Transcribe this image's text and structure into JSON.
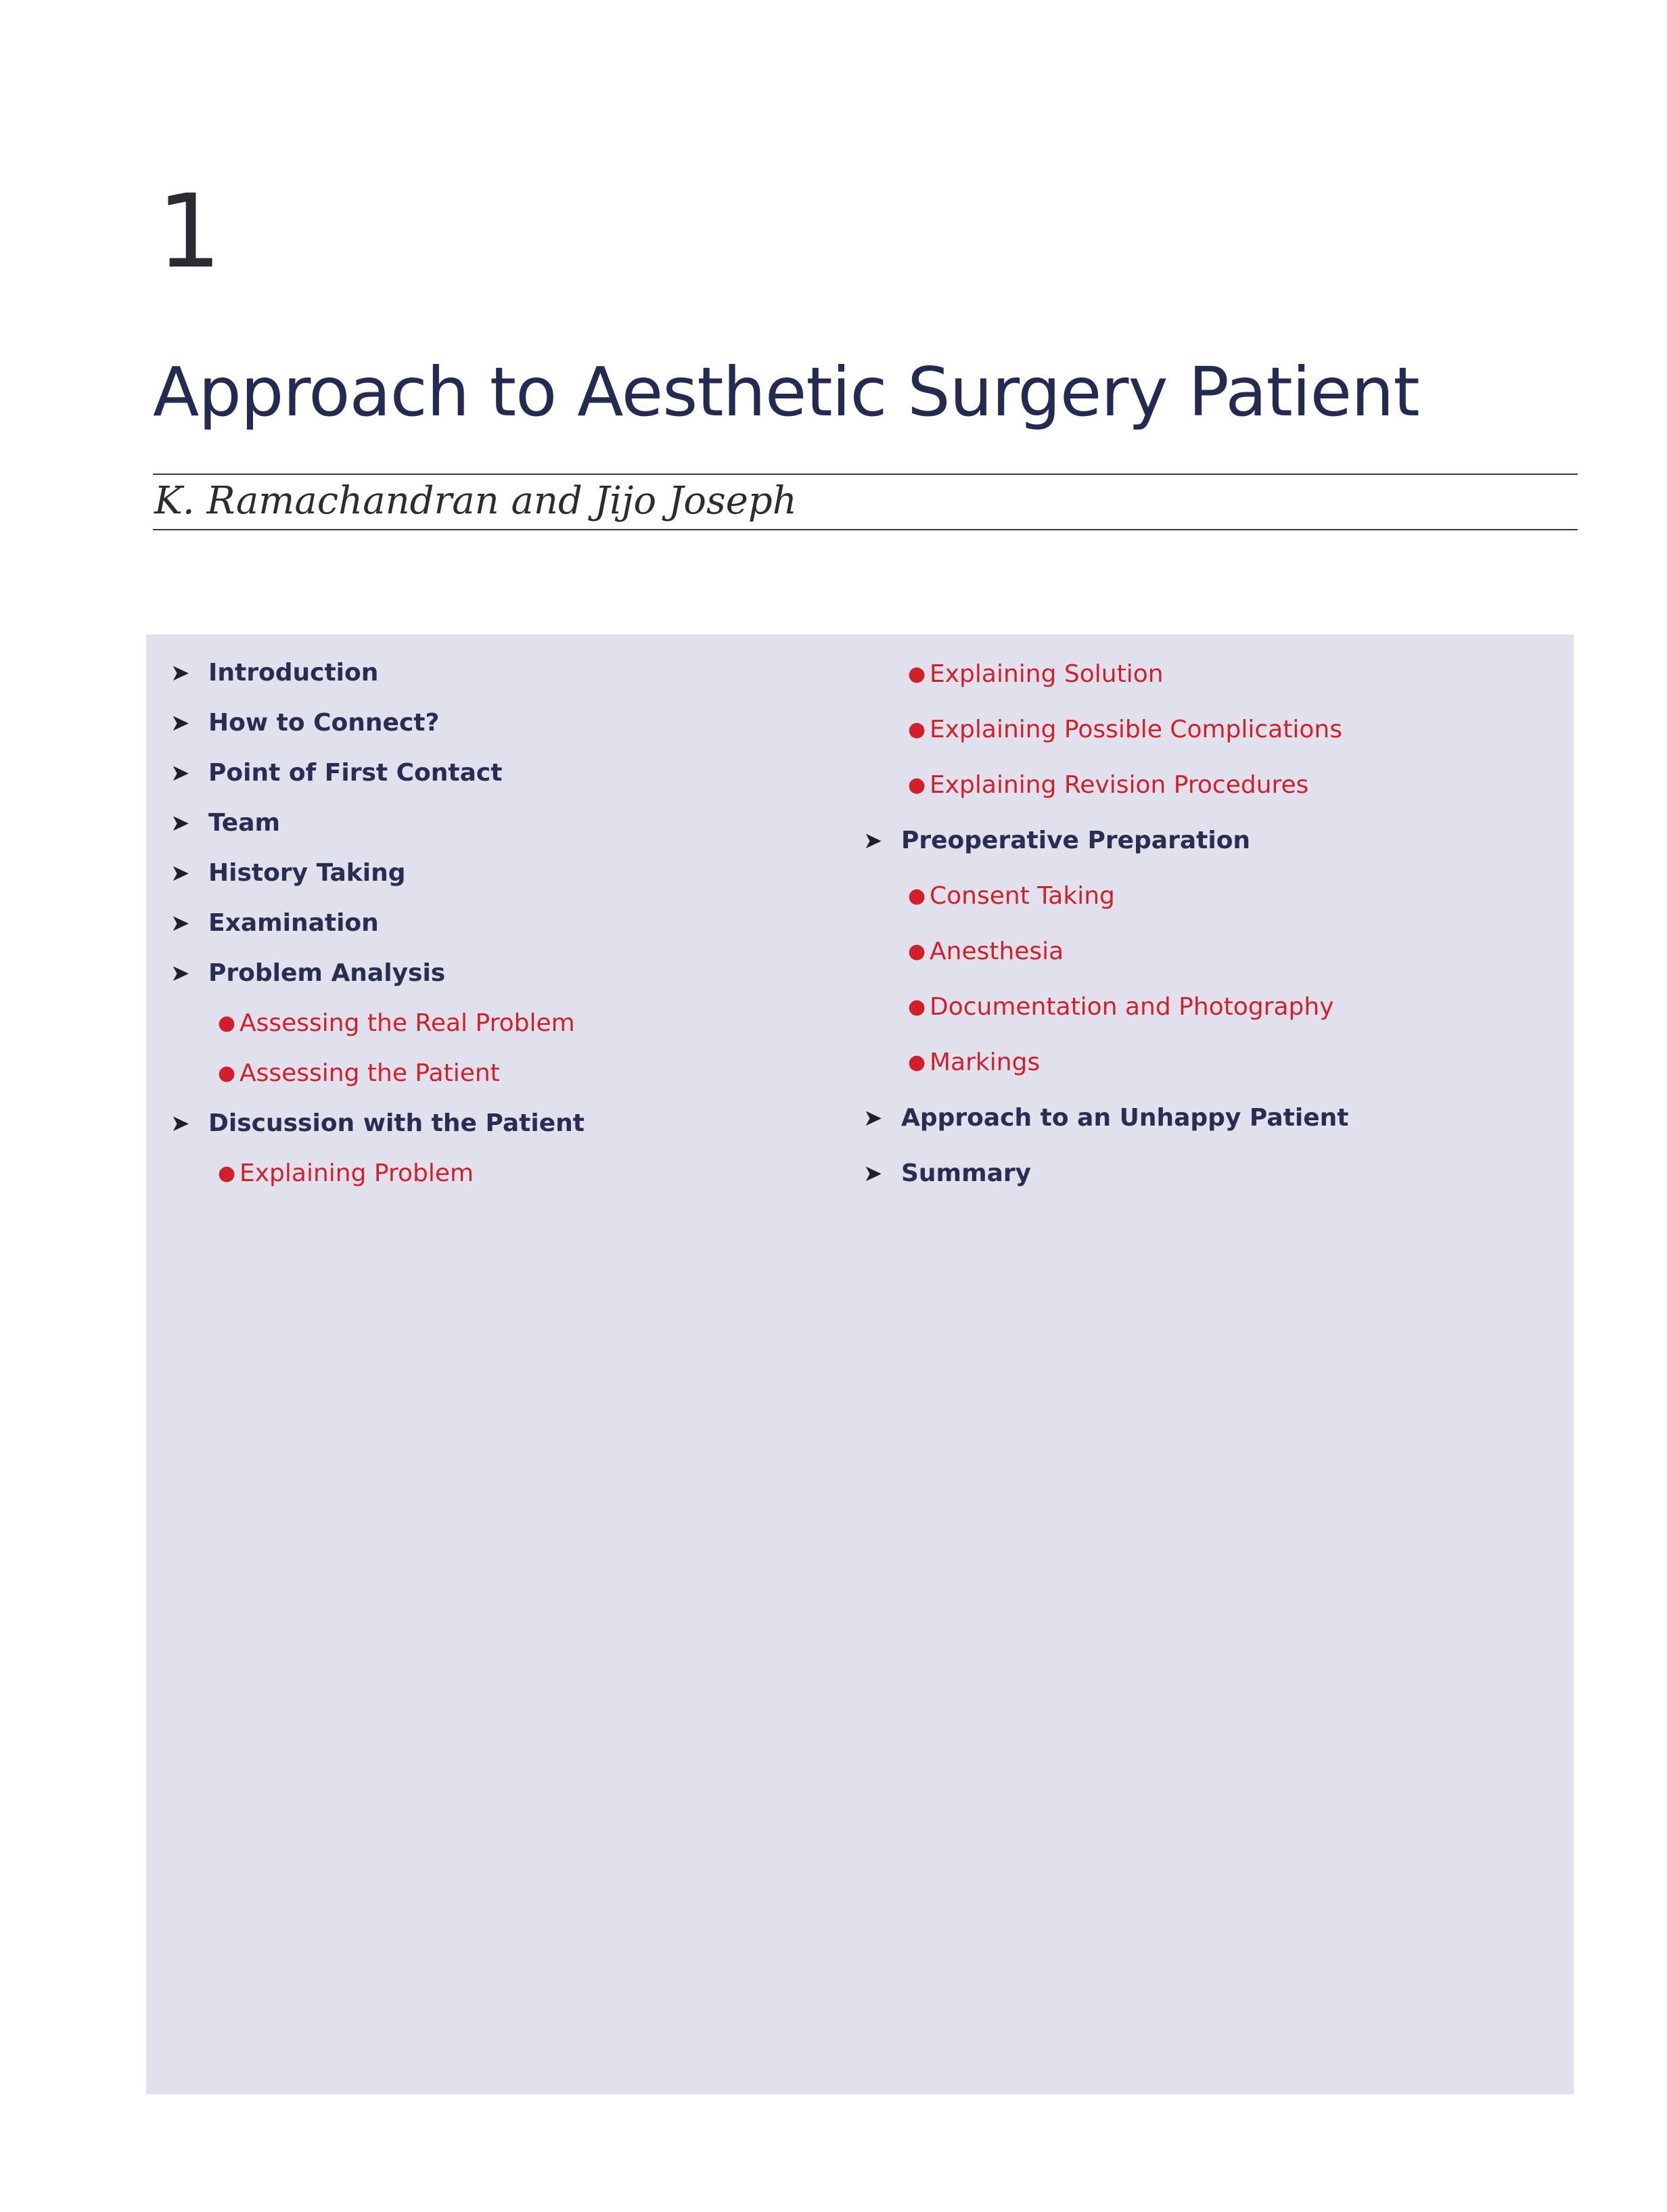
{
  "chapter": {
    "number": "1",
    "title": "Approach to Aesthetic Surgery Patient",
    "authors": "K. Ramachandran and Jijo Joseph"
  },
  "toc": {
    "left": [
      {
        "level": "main",
        "label": "Introduction"
      },
      {
        "level": "main",
        "label": "How to Connect?"
      },
      {
        "level": "main",
        "label": "Point of First Contact"
      },
      {
        "level": "main",
        "label": "Team"
      },
      {
        "level": "main",
        "label": "History Taking"
      },
      {
        "level": "main",
        "label": "Examination"
      },
      {
        "level": "main",
        "label": "Problem Analysis"
      },
      {
        "level": "sub",
        "label": "Assessing the Real Problem"
      },
      {
        "level": "sub",
        "label": "Assessing the Patient"
      },
      {
        "level": "main",
        "label": "Discussion with the Patient"
      },
      {
        "level": "sub",
        "label": "Explaining Problem"
      }
    ],
    "right": [
      {
        "level": "sub",
        "label": "Explaining Solution"
      },
      {
        "level": "sub",
        "label": "Explaining Possible Complications"
      },
      {
        "level": "sub",
        "label": "Explaining Revision Procedures"
      },
      {
        "level": "main",
        "label": "Preoperative Preparation"
      },
      {
        "level": "sub",
        "label": "Consent Taking"
      },
      {
        "level": "sub",
        "label": "Anesthesia"
      },
      {
        "level": "sub",
        "label": "Documentation and Photography"
      },
      {
        "level": "sub",
        "label": "Markings"
      },
      {
        "level": "main",
        "label": "Approach to an Unhappy Patient"
      },
      {
        "level": "main",
        "label": "Summary"
      }
    ],
    "main_marker_icon": "arrowhead-bullet-icon",
    "sub_marker_icon": "dot-bullet-icon",
    "main_color": "#2a2d52",
    "sub_color": "#d21f2a",
    "panel_color": "#e0e1ec"
  }
}
